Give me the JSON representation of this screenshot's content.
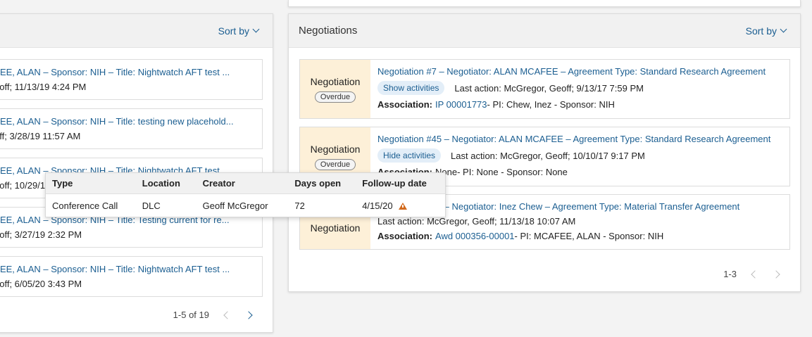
{
  "left_panel": {
    "sort_label": "Sort by",
    "cards": [
      {
        "title": "FEE, ALAN – Sponsor: NIH – Title: Nightwatch AFT test ...",
        "meta": "eoff; 11/13/19 4:24 PM"
      },
      {
        "title": "FEE, ALAN – Sponsor: NIH – Title: testing new placehold...",
        "meta": "off; 3/28/19 11:57 AM"
      },
      {
        "title": "FEE, ALAN – Sponsor: NIH – Title: Nightwatch AFT test ...",
        "meta": "eoff; 10/29/19"
      },
      {
        "title": "FEE, ALAN – Sponsor: NIH – Title: Testing current for re...",
        "meta": "eoff; 3/27/19 2:32 PM"
      },
      {
        "title": "FEE, ALAN – Sponsor: NIH – Title: Nightwatch AFT test ...",
        "meta": "eoff; 6/05/20 3:43 PM"
      }
    ],
    "pager_text": "1-5 of 19"
  },
  "right_panel": {
    "title": "Negotiations",
    "sort_label": "Sort by",
    "cards": [
      {
        "status": "Negotiation",
        "badge": "Overdue",
        "title": "Negotiation #7 – Negotiator: ALAN MCAFEE – Agreement Type: Standard Research Agreement",
        "activities_label": "Show activities",
        "last_action": "Last action: McGregor, Geoff; 9/13/17 7:59 PM",
        "assoc_label": "Association:",
        "assoc_link": "IP 00001773",
        "assoc_rest": " - PI: Chew, Inez - Sponsor: NIH"
      },
      {
        "status": "Negotiation",
        "badge": "Overdue",
        "title": "Negotiation #45 – Negotiator: ALAN MCAFEE – Agreement Type: Standard Research Agreement",
        "activities_label": "Hide activities",
        "last_action": "Last action: McGregor, Geoff; 10/10/17 9:17 PM",
        "assoc_label": "Association:",
        "assoc_link": "None",
        "assoc_rest": " - PI: None - Sponsor: None"
      },
      {
        "status": "Negotiation",
        "title": "Negotiation #58 – Negotiator: Inez Chew – Agreement Type: Material Transfer Agreement",
        "last_action": "Last action: McGregor, Geoff; 11/13/18 10:07 AM",
        "assoc_label": "Association:",
        "assoc_link": "Awd 000356-00001",
        "assoc_rest": " - PI: MCAFEE, ALAN - Sponsor: NIH"
      }
    ],
    "pager_text": "1-3"
  },
  "activities_popup": {
    "headers": [
      "Type",
      "Location",
      "Creator",
      "Days open",
      "Follow-up date"
    ],
    "row": [
      "Conference Call",
      "DLC",
      "Geoff McGregor",
      "72",
      "4/15/20"
    ],
    "warning_color": "#d26a1d"
  }
}
